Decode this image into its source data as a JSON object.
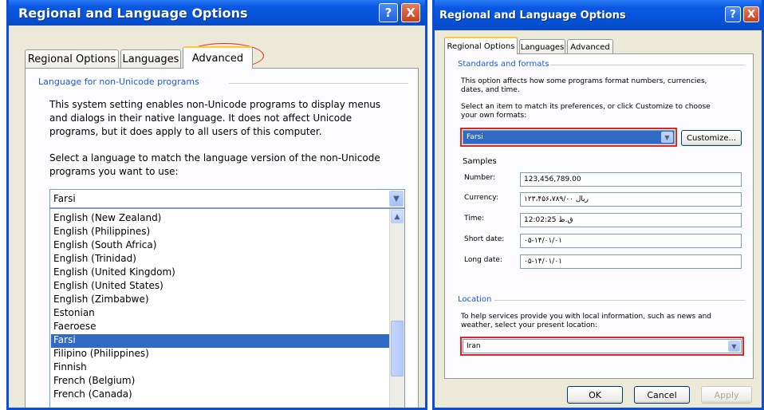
{
  "left_dialog": {
    "title": "Regional and Language Options",
    "help_glyph": "?",
    "close_glyph": "X",
    "tabs": [
      "Regional Options",
      "Languages",
      "Advanced"
    ],
    "active_tab": "Advanced",
    "group_label": "Language for non-Unicode programs",
    "description": [
      "This system setting enables non-Unicode programs to display menus",
      "and dialogs in their native language. It does not affect Unicode",
      "programs, but it does apply to all users of this computer."
    ],
    "select_prompt": [
      "Select a language to match the language version of the non-Unicode",
      "programs you want to use:"
    ],
    "combo_value": "Farsi",
    "list_items": [
      "English (New Zealand)",
      "English (Philippines)",
      "English (South Africa)",
      "English (Trinidad)",
      "English (United Kingdom)",
      "English (United States)",
      "English (Zimbabwe)",
      "Estonian",
      "Faeroese",
      "Farsi",
      "Filipino (Philippines)",
      "Finnish",
      "French (Belgium)",
      "French (Canada)"
    ],
    "selected_item": "Farsi",
    "highlight_color": "#E02424"
  },
  "right_dialog": {
    "title": "Regional and Language Options",
    "help_glyph": "?",
    "close_glyph": "X",
    "tabs": [
      "Regional Options",
      "Languages",
      "Advanced"
    ],
    "active_tab": "Regional Options",
    "standards_label": "Standards and formats",
    "standards_desc": [
      "This option affects how some programs format numbers, currencies,",
      "dates, and time."
    ],
    "standards_prompt": [
      "Select an item to match its preferences, or click Customize to choose",
      "your own formats:"
    ],
    "format_value": "Farsi",
    "customize_label": "Customize...",
    "samples_label": "Samples",
    "samples": [
      {
        "label": "Number:",
        "value": "123,456,789.00"
      },
      {
        "label": "Currency:",
        "value": "۱۲۳،۴۵۶،۷۸۹/۰۰ ریال"
      },
      {
        "label": "Time:",
        "value": "12:02:25 ق.ظ"
      },
      {
        "label": "Short date:",
        "value": "۰۵-۱۴/۰۱/۰۱"
      },
      {
        "label": "Long date:",
        "value": "۰۵-۱۴/۰۱/۰۱"
      }
    ],
    "location_label": "Location",
    "location_desc": [
      "To help services provide you with local information, such as news and",
      "weather, select your present location:"
    ],
    "location_value": "Iran",
    "buttons": {
      "ok": "OK",
      "cancel": "Cancel",
      "apply": "Apply"
    },
    "highlight_color": "#E02424"
  }
}
